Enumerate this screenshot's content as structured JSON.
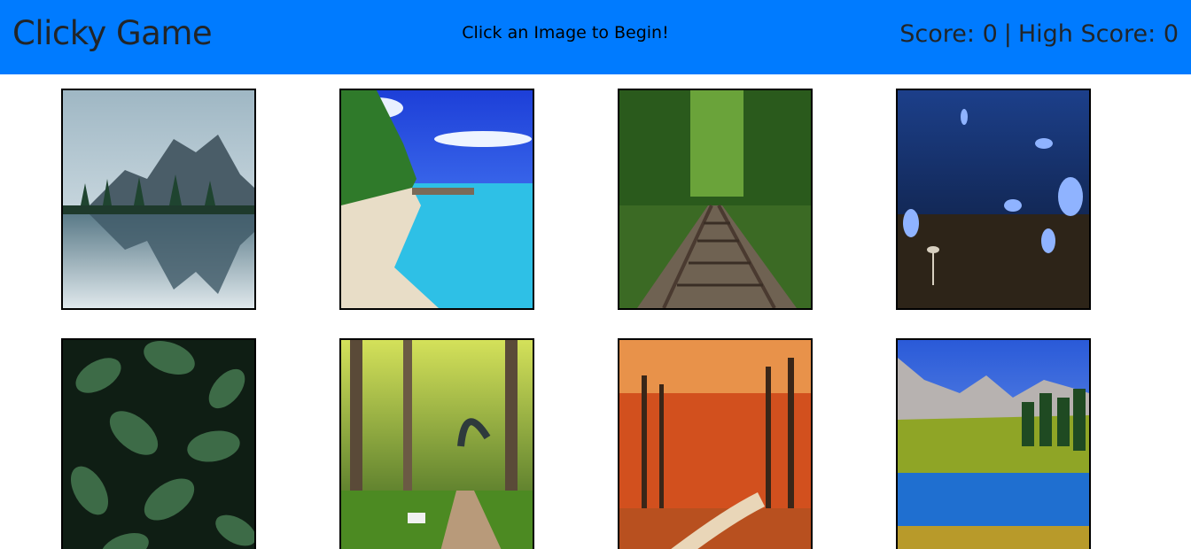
{
  "header": {
    "brand": "Clicky Game",
    "status_message": "Click an Image to Begin!",
    "score_label": "Score:",
    "score": 0,
    "separator": "|",
    "high_score_label": "High Score:",
    "high_score": 0,
    "background_color": "#007bff"
  },
  "images": [
    {
      "name": "mountain-lake-image",
      "subject": "mountain reflection lake"
    },
    {
      "name": "tropical-beach-image",
      "subject": "tropical beach"
    },
    {
      "name": "forest-railway-image",
      "subject": "railway through forest"
    },
    {
      "name": "blue-butterflies-image",
      "subject": "blue butterflies"
    },
    {
      "name": "green-leaves-image",
      "subject": "green leaves"
    },
    {
      "name": "park-path-image",
      "subject": "park path with bench"
    },
    {
      "name": "autumn-forest-image",
      "subject": "autumn forest road"
    },
    {
      "name": "alpine-lake-image",
      "subject": "alpine lake"
    }
  ]
}
